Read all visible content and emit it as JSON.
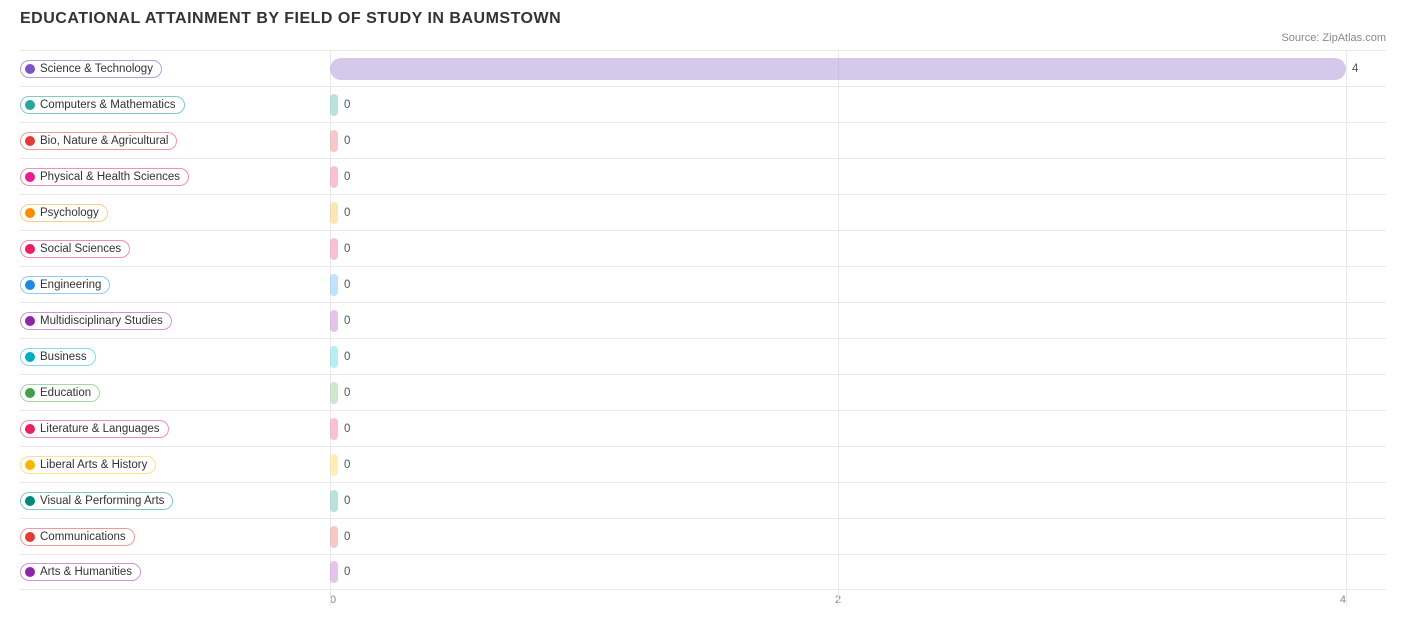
{
  "title": "EDUCATIONAL ATTAINMENT BY FIELD OF STUDY IN BAUMSTOWN",
  "source": "Source: ZipAtlas.com",
  "chart": {
    "x_axis_labels": [
      "0",
      "2",
      "4"
    ],
    "x_max": 4,
    "bars": [
      {
        "label": "Science & Technology",
        "value": 4,
        "color": "#b39ddb",
        "dot": "#7c52c8",
        "border": "#b39ddb"
      },
      {
        "label": "Computers & Mathematics",
        "value": 0,
        "color": "#80cbc4",
        "dot": "#26a69a",
        "border": "#80cbc4"
      },
      {
        "label": "Bio, Nature & Agricultural",
        "value": 0,
        "color": "#ef9a9a",
        "dot": "#e53935",
        "border": "#ef9a9a"
      },
      {
        "label": "Physical & Health Sciences",
        "value": 0,
        "color": "#f48fb1",
        "dot": "#e91e8c",
        "border": "#f48fb1"
      },
      {
        "label": "Psychology",
        "value": 0,
        "color": "#ffcc80",
        "dot": "#fb8c00",
        "border": "#ffcc80"
      },
      {
        "label": "Social Sciences",
        "value": 0,
        "color": "#f48fb1",
        "dot": "#e91e63",
        "border": "#f48fb1"
      },
      {
        "label": "Engineering",
        "value": 0,
        "color": "#90caf9",
        "dot": "#1e88e5",
        "border": "#90caf9"
      },
      {
        "label": "Multidisciplinary Studies",
        "value": 0,
        "color": "#ce93d8",
        "dot": "#8e24aa",
        "border": "#ce93d8"
      },
      {
        "label": "Business",
        "value": 0,
        "color": "#80deea",
        "dot": "#00acc1",
        "border": "#80deea"
      },
      {
        "label": "Education",
        "value": 0,
        "color": "#a5d6a7",
        "dot": "#43a047",
        "border": "#a5d6a7"
      },
      {
        "label": "Literature & Languages",
        "value": 0,
        "color": "#f48fb1",
        "dot": "#e91e63",
        "border": "#f48fb1"
      },
      {
        "label": "Liberal Arts & History",
        "value": 0,
        "color": "#ffe082",
        "dot": "#ffb300",
        "border": "#ffe082"
      },
      {
        "label": "Visual & Performing Arts",
        "value": 0,
        "color": "#80cbc4",
        "dot": "#00897b",
        "border": "#80cbc4"
      },
      {
        "label": "Communications",
        "value": 0,
        "color": "#ef9a9a",
        "dot": "#e53935",
        "border": "#ef9a9a"
      },
      {
        "label": "Arts & Humanities",
        "value": 0,
        "color": "#ce93d8",
        "dot": "#8e24aa",
        "border": "#ce93d8"
      }
    ]
  }
}
